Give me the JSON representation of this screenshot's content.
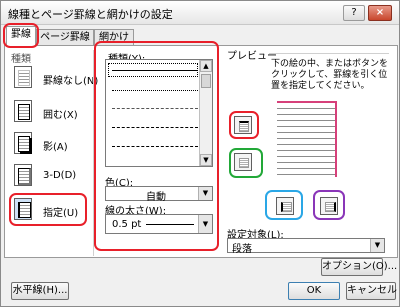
{
  "window": {
    "title": "線種とページ罫線と網かけの設定",
    "help_label": "?",
    "close_label": "×"
  },
  "tabs": [
    {
      "label": "罫線",
      "active": true
    },
    {
      "label": "ページ罫線",
      "active": false
    },
    {
      "label": "網かけ",
      "active": false
    }
  ],
  "setting": {
    "group_label": "種類",
    "items": [
      {
        "label": "罫線なし(N)",
        "icon": "no-border-icon"
      },
      {
        "label": "囲む(X)",
        "icon": "box-border-icon"
      },
      {
        "label": "影(A)",
        "icon": "shadow-border-icon"
      },
      {
        "label": "3-D(D)",
        "icon": "3d-border-icon"
      },
      {
        "label": "指定(U)",
        "icon": "custom-border-icon",
        "selected": true
      }
    ]
  },
  "style": {
    "label": "種類(Y):",
    "line_styles": [
      "solid",
      "dotted",
      "dashed-small",
      "dashed",
      "dash-dot"
    ],
    "color_label": "色(C):",
    "color_value": "自動",
    "width_label": "線の太さ(W):",
    "width_value": "0.5 pt"
  },
  "preview": {
    "label": "プレビュー",
    "hint": "下の絵の中、またはボタンを\nクリックして、罫線を引く位\n置を指定してください。",
    "apply_label": "設定対象(L):",
    "apply_value": "段落",
    "options_label": "オプション(O)..."
  },
  "footer": {
    "horizontal_line_label": "水平線(H)...",
    "ok_label": "OK",
    "cancel_label": "キャンセル"
  },
  "colors": {
    "red": "#e8202a",
    "green": "#22a838",
    "blue": "#2aa7e6",
    "purple": "#8a36b8",
    "preview_accent": "#d6407a"
  }
}
